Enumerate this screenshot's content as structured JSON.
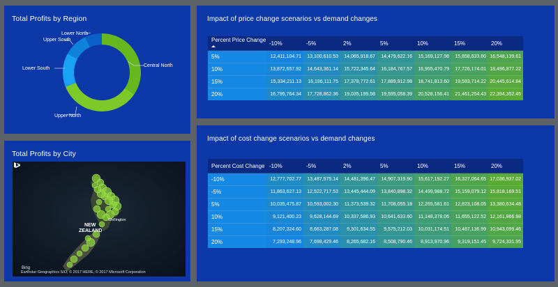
{
  "region_panel": {
    "title": "Total Profits by Region",
    "segments": [
      {
        "label": "Central North",
        "share": 0.345,
        "color": "#67b81e"
      },
      {
        "label": "Upper North",
        "share": 0.345,
        "color": "#7cc928"
      },
      {
        "label": "Lower South",
        "share": 0.14,
        "color": "#1aa3f5"
      },
      {
        "label": "Upper South",
        "share": 0.1,
        "color": "#0f82da"
      },
      {
        "label": "Lower North",
        "share": 0.07,
        "color": "#0b5fc9"
      }
    ]
  },
  "city_panel": {
    "title": "Total Profits by City",
    "map_label_country_1": "NEW",
    "map_label_country_2": "ZEALAND",
    "map_label_city": "Wellington",
    "bing_label": "Bing",
    "credit": "Earthstar Geographics SIO, © 2017 HERE, © 2017 Microsoft Corporation"
  },
  "price_panel": {
    "title": "Impact of price change scenarios vs demand changes",
    "row_header": "Percent Price Change",
    "columns": [
      "-10%",
      "-5%",
      "2%",
      "5%",
      "10%",
      "15%",
      "20%"
    ],
    "rows": [
      {
        "label": "5%",
        "values": [
          "12,411,104.71",
          "13,100,610.53",
          "14,065,918.67",
          "14,479,622.16",
          "15,169,127.98",
          "15,858,633.80",
          "16,548,139.61"
        ]
      },
      {
        "label": "10%",
        "values": [
          "13,872,657.92",
          "14,643,361.14",
          "15,722,345.64",
          "16,184,767.57",
          "16,955,470.79",
          "17,726,174.01",
          "18,496,877.22"
        ]
      },
      {
        "label": "15%",
        "values": [
          "15,334,211.13",
          "16,186,111.75",
          "17,378,772.61",
          "17,889,912.98",
          "18,741,813.60",
          "19,593,714.22",
          "20,445,614.84"
        ]
      },
      {
        "label": "20%",
        "values": [
          "16,795,764.34",
          "17,728,862.36",
          "19,035,199.58",
          "19,595,058.39",
          "20,528,156.41",
          "21,461,254.43",
          "22,394,352.45"
        ]
      }
    ]
  },
  "cost_panel": {
    "title": "Impact of cost change scenarios vs demand changes",
    "row_header": "Percent Cost Change",
    "columns": [
      "-10%",
      "-5%",
      "2%",
      "5%",
      "10%",
      "15%",
      "20%"
    ],
    "rows": [
      {
        "label": "-10%",
        "values": [
          "12,777,702.77",
          "13,487,575.14",
          "14,481,396.47",
          "14,907,319.90",
          "15,617,192.27",
          "16,327,064.65",
          "17,036,937.02"
        ]
      },
      {
        "label": "-5%",
        "values": [
          "11,863,627.13",
          "12,522,717.53",
          "13,445,444.09",
          "13,840,898.32",
          "14,499,988.72",
          "15,159,079.12",
          "15,818,169.51"
        ]
      },
      {
        "label": "5%",
        "values": [
          "10,035,475.87",
          "10,593,002.30",
          "11,373,539.32",
          "11,708,055.18",
          "12,265,581.61",
          "12,823,108.05",
          "13,380,634.48"
        ]
      },
      {
        "label": "10%",
        "values": [
          "9,121,400.23",
          "9,628,144.69",
          "10,337,586.93",
          "10,641,633.60",
          "11,148,378.06",
          "11,655,122.52",
          "12,161,866.98"
        ]
      },
      {
        "label": "15%",
        "values": [
          "8,207,324.60",
          "8,663,287.08",
          "9,301,634.55",
          "9,575,212.03",
          "10,031,174.51",
          "10,487,136.99",
          "10,943,099.46"
        ]
      },
      {
        "label": "20%",
        "values": [
          "7,293,248.96",
          "7,698,429.46",
          "8,265,682.16",
          "8,508,790.46",
          "8,913,970.96",
          "9,319,151.45",
          "9,724,331.95"
        ]
      }
    ]
  },
  "colors": {
    "panel_bg": "#0d38a8",
    "page_bg": "#5d6168",
    "header_bg": "#0a2a82",
    "heat_low": "#1684e0",
    "heat_high": "#59ab33"
  }
}
